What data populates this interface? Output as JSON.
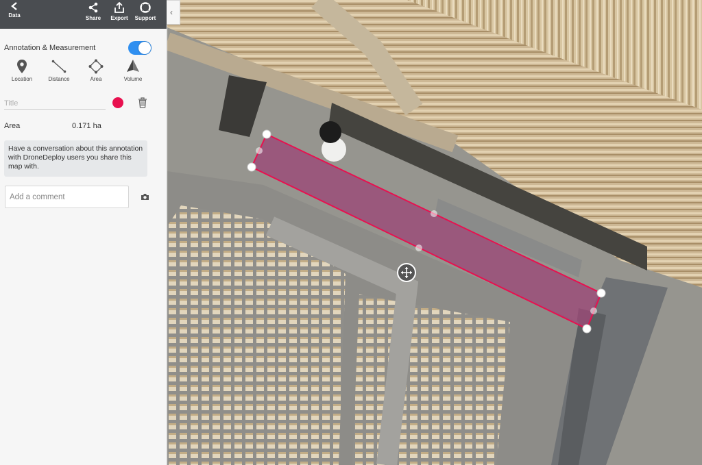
{
  "toolbar": {
    "data_label": "Data",
    "share_label": "Share",
    "export_label": "Export",
    "support_label": "Support"
  },
  "annotation": {
    "title": "Annotation & Measurement",
    "toggle_on": true,
    "tools": [
      {
        "label": "Location",
        "icon": "pin-icon"
      },
      {
        "label": "Distance",
        "icon": "line-icon"
      },
      {
        "label": "Area",
        "icon": "polygon-icon"
      },
      {
        "label": "Volume",
        "icon": "volume-icon"
      }
    ],
    "title_placeholder": "Title",
    "color": "#e8104f",
    "area_label": "Area",
    "area_value": "0.171 ha",
    "info_text": "Have a conversation about this annotation with DroneDeploy users you share this map with.",
    "comment_placeholder": "Add a comment"
  },
  "colors": {
    "toolbar_bg": "#4a4d51",
    "toggle_accent": "#2f8ff0",
    "polygon_fill": "#9b4a78",
    "polygon_stroke": "#e8104f"
  }
}
